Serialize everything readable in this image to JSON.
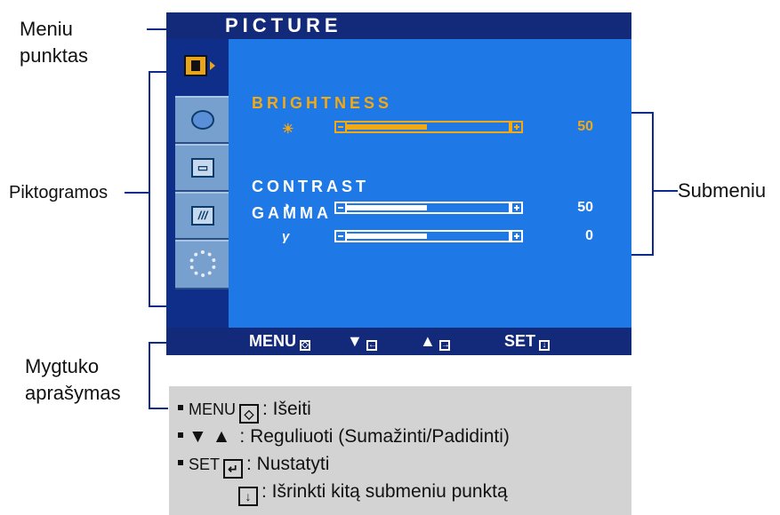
{
  "annotations": {
    "meniu_punktas": "Meniu\npunktas",
    "piktogramos": "Piktogramos",
    "submeniu": "Submeniu",
    "mygtuko_aprasymas": "Mygtuko\naprašymas"
  },
  "osd": {
    "title": "PICTURE",
    "menu_icons": [
      "picture-icon",
      "color-icon",
      "position-icon",
      "tracking-icon",
      "setup-icon"
    ],
    "submenu": [
      {
        "label": "BRIGHTNESS",
        "symbol": "☀",
        "value": "50",
        "level": 0.5,
        "selected": true
      },
      {
        "label": "CONTRAST",
        "symbol": "◑",
        "value": "50",
        "level": 0.5,
        "selected": false
      },
      {
        "label": "GAMMA",
        "symbol": "γ",
        "value": "0",
        "level": 0.5,
        "selected": false
      }
    ],
    "buttons": {
      "menu": "MENU",
      "down": "▼",
      "up": "▲",
      "set": "SET"
    },
    "colors": {
      "background": "#1e78e6",
      "bar": "#13297a",
      "selected": "#f2a914",
      "text": "#ffffff"
    }
  },
  "legend": {
    "menu_key": "MENU",
    "menu_desc": ": Išeiti",
    "arrows_key": "▼ ▲",
    "arrows_desc": ": Reguliuoti (Sumažinti/Padidinti)",
    "set_key": "SET",
    "set_desc": ": Nustatyti",
    "next_desc": ": Išrinkti kitą submeniu punktą"
  }
}
